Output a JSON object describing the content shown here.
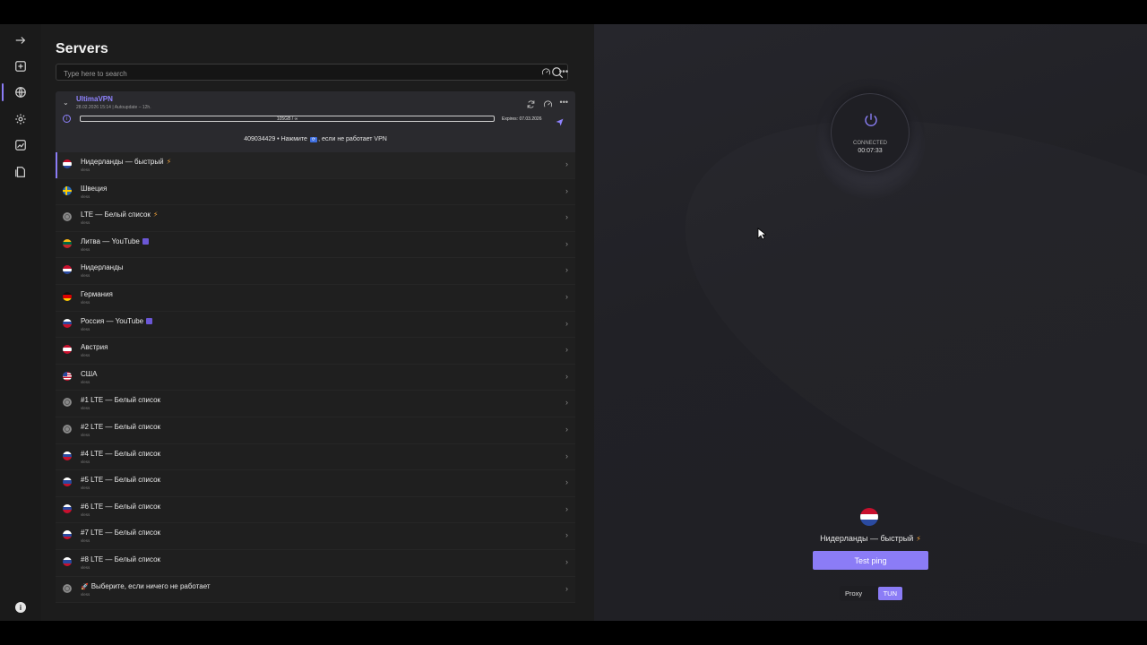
{
  "panel": {
    "title": "Servers",
    "search_placeholder": "Type here to search"
  },
  "subscription": {
    "name": "UltimaVPN",
    "meta": "28.02.2026 15:14 | Autoupdate – 12h.",
    "traffic": "105GB / ∞",
    "expires": "Expires: 07.03.2026",
    "notice_pre": "409034429 • Нажмите",
    "notice_key": "⟳",
    "notice_post": ", если не работает VPN"
  },
  "servers": [
    {
      "name": "Нидерланды — быстрый",
      "proto": "vless",
      "flag": "nl",
      "tag": "bolt"
    },
    {
      "name": "Швеция",
      "proto": "vless",
      "flag": "se",
      "tag": ""
    },
    {
      "name": "LTE — Белый список",
      "proto": "vless",
      "flag": "globe",
      "tag": "bolt"
    },
    {
      "name": "Литва — YouTube",
      "proto": "vless",
      "flag": "lt",
      "tag": "yt"
    },
    {
      "name": "Нидерланды",
      "proto": "vless",
      "flag": "nl",
      "tag": ""
    },
    {
      "name": "Германия",
      "proto": "vless",
      "flag": "de",
      "tag": ""
    },
    {
      "name": "Россия — YouTube",
      "proto": "vless",
      "flag": "ru",
      "tag": "yt"
    },
    {
      "name": "Австрия",
      "proto": "vless",
      "flag": "at",
      "tag": ""
    },
    {
      "name": "США",
      "proto": "vless",
      "flag": "us",
      "tag": ""
    },
    {
      "name": "#1 LTE — Белый список",
      "proto": "vless",
      "flag": "globe",
      "tag": ""
    },
    {
      "name": "#2 LTE — Белый список",
      "proto": "vless",
      "flag": "globe",
      "tag": ""
    },
    {
      "name": "#4 LTE — Белый список",
      "proto": "vless",
      "flag": "ru",
      "tag": ""
    },
    {
      "name": "#5 LTE — Белый список",
      "proto": "vless",
      "flag": "ru",
      "tag": ""
    },
    {
      "name": "#6 LTE — Белый список",
      "proto": "vless",
      "flag": "ru",
      "tag": ""
    },
    {
      "name": "#7 LTE — Белый список",
      "proto": "vless",
      "flag": "ru",
      "tag": ""
    },
    {
      "name": "#8 LTE — Белый список",
      "proto": "vless",
      "flag": "ru",
      "tag": ""
    },
    {
      "name": "Выберите, если ничего не работает",
      "proto": "vless",
      "flag": "globe",
      "tag": "rocket"
    }
  ],
  "connection": {
    "status": "CONNECTED",
    "time": "00:07:33",
    "selected": "Нидерланды — быстрый",
    "ping_label": "Test ping",
    "mode_proxy": "Proxy",
    "mode_tun": "TUN"
  },
  "colors": {
    "accent": "#8b7cf6",
    "bolt": "#f0a13a"
  }
}
